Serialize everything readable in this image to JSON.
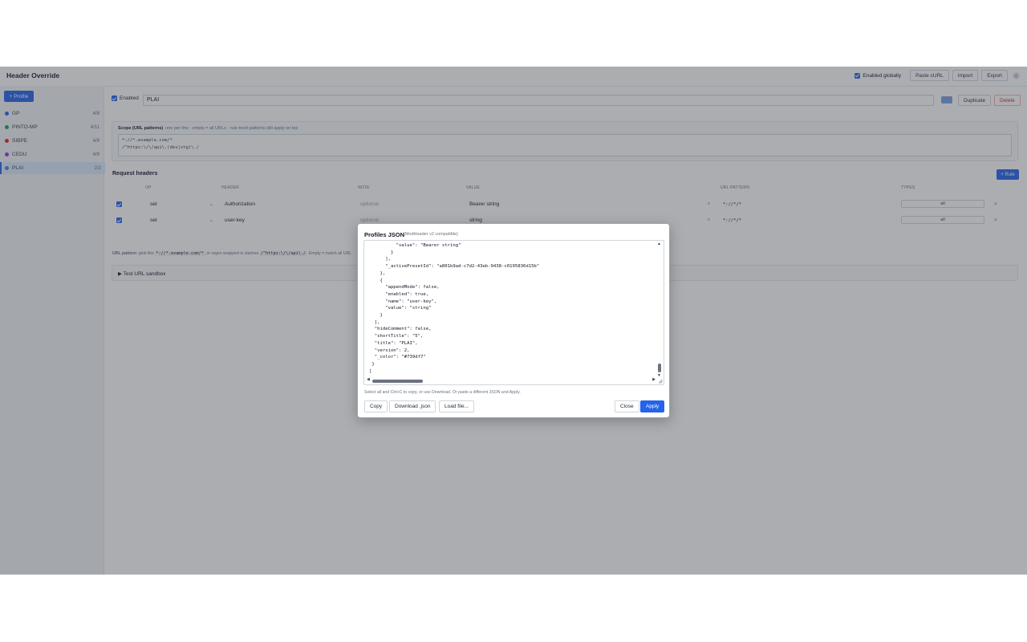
{
  "app": {
    "title": "Header Override"
  },
  "toolbar": {
    "enabled_globally_label": "Enabled globally",
    "paste_curl_label": "Paste cURL",
    "import_label": "Import",
    "export_label": "Export",
    "theme_icon": "sun-icon"
  },
  "sidebar": {
    "add_profile_label": "+ Profile",
    "profiles": [
      {
        "name": "GP",
        "count": "4/8",
        "color": "#2563eb"
      },
      {
        "name": "PINTO-MP",
        "count": "4/11",
        "color": "#16a34a"
      },
      {
        "name": "SIBPE",
        "count": "4/9",
        "color": "#dc2626"
      },
      {
        "name": "CEDU",
        "count": "4/9",
        "color": "#9333ea"
      },
      {
        "name": "PLAI",
        "count": "2/2",
        "color": "#4f7fd6",
        "active": true
      }
    ]
  },
  "profile": {
    "enabled_label": "Enabled",
    "title_value": "PLAI",
    "color": "#739df7",
    "duplicate_label": "Duplicate",
    "delete_label": "Delete"
  },
  "scope": {
    "title": "Scope (URL patterns)",
    "hint": "one per line · empty = all URLs · rule-level patterns still apply on top",
    "lines": [
      "*://*.example.com/*",
      "/^https:\\/\\/api\\.(dev|stg)\\./"
    ]
  },
  "request_headers": {
    "title": "Request headers",
    "add_rule_label": "+ Rule",
    "columns": [
      "OP",
      "HEADER",
      "NOTE",
      "VALUE",
      "URL PATTERN",
      "TYPES"
    ],
    "rules": [
      {
        "op": "set",
        "header": "Authorization",
        "note": "optional",
        "value": "Bearer string",
        "url_pattern": "*://*/*",
        "types": "all"
      },
      {
        "op": "set",
        "header": "user-key",
        "note": "optional",
        "value": "string",
        "url_pattern": "*://*/*",
        "types": "all"
      }
    ],
    "url_hint": {
      "label": "URL pattern:",
      "text1": "glob like",
      "code1": "*://*.example.com/*",
      "text2": ", or regex wrapped in slashes",
      "code2": "/^https:\\/\\/api\\./",
      "text3": ". Empty = match all URL"
    }
  },
  "sandbox": {
    "label": "▶ Test URL sandbox"
  },
  "modal": {
    "title": "Profiles JSON",
    "subtitle": "(ModHeader v2 compatible)",
    "json_text": "          \"value\": \"Bearer string\"\n        }\n      ],\n      \"_activePresetId\": \"a801b9ad-c7d2-43eb-9438-c0195836d15b\"\n    },\n    {\n      \"appendMode\": false,\n      \"enabled\": true,\n      \"name\": \"user-key\",\n      \"value\": \"string\"\n    }\n  ],\n  \"hideComment\": false,\n  \"shortTitle\": \"5\",\n  \"title\": \"PLAI\",\n  \"version\": 2,\n  \"_color\": \"#739df7\"\n }\n]",
    "hint": "Select all and Ctrl+C to copy, or use Download. Or paste a different JSON and Apply.",
    "copy_label": "Copy",
    "download_label": "Download .json",
    "load_label": "Load file...",
    "close_label": "Close",
    "apply_label": "Apply"
  }
}
